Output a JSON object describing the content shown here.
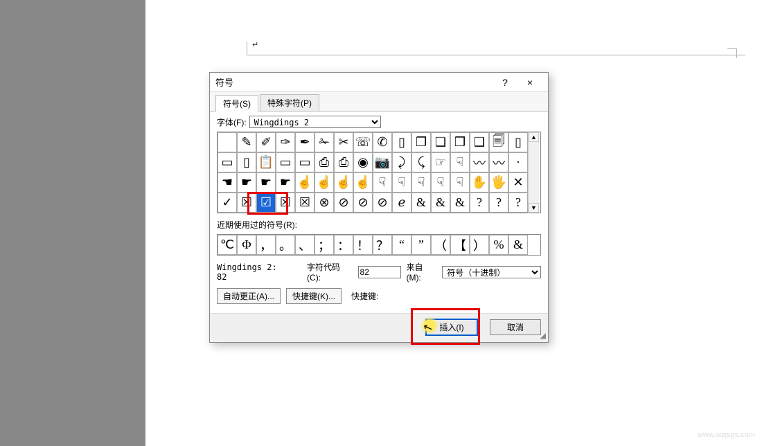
{
  "dialog": {
    "title": "符号",
    "help": "?",
    "close": "×",
    "tabs": {
      "symbols": "符号(S)",
      "special": "特殊字符(P)"
    },
    "font_label": "字体(F):",
    "font_value": "Wingdings 2",
    "recent_label": "近期使用过的符号(R):",
    "unicode_name": "Wingdings 2: 82",
    "char_code_label": "字符代码(C):",
    "char_code_value": "82",
    "from_label": "来自(M):",
    "from_value": "符号（十进制）",
    "autocorrect": "自动更正(A)...",
    "shortcut": "快捷键(K)...",
    "shortcut_label": "快捷键:",
    "insert": "插入(I)",
    "cancel": "取消"
  },
  "grid": {
    "rows": [
      [
        "",
        "pen1",
        "pen2",
        "pen3",
        "pen4",
        "scissors1",
        "scissors2",
        "phone",
        "phone2",
        "page",
        "pages",
        "pages2",
        "pages3",
        "pages4",
        "files",
        "page2"
      ],
      [
        "rect",
        "doc",
        "clip",
        "book",
        "book2",
        "print",
        "print2",
        "target",
        "camera",
        "curl",
        "curl2",
        "hand-l",
        "hand-r",
        "swoosh",
        "swoosh2",
        "dot"
      ],
      [
        "point-l",
        "point-r",
        "point-r2",
        "point-r3",
        "finger-u",
        "finger-u2",
        "finger-u3",
        "finger-u4",
        "finger-d",
        "finger-d2",
        "finger-d3",
        "finger-d4",
        "finger-d5",
        "stop",
        "wave",
        "x"
      ],
      [
        "check",
        "xbox1",
        "checkbox",
        "xbox2",
        "xbox3",
        "circle-x",
        "circle-o",
        "prohibit",
        "prohibit2",
        "er",
        "amp",
        "amp2",
        "amp3",
        "q1",
        "q2",
        "q3"
      ]
    ],
    "selected": {
      "row": 3,
      "col": 2
    }
  },
  "glyph_map": {
    "pen1": "✎",
    "pen2": "✐",
    "pen3": "✑",
    "pen4": "✒",
    "scissors1": "✁",
    "scissors2": "✂",
    "phone": "☏",
    "phone2": "✆",
    "page": "▯",
    "pages": "❐",
    "pages2": "❏",
    "pages3": "❒",
    "pages4": "❑",
    "files": "🗐",
    "page2": "▯",
    "rect": "▭",
    "doc": "▯",
    "clip": "📋",
    "book": "▭",
    "book2": "▭",
    "print": "⎙",
    "print2": "⎙",
    "target": "◉",
    "camera": "📷",
    "curl": "⤸",
    "curl2": "⤹",
    "hand-l": "☞",
    "hand-r": "☟",
    "swoosh": "〰",
    "swoosh2": "〰",
    "dot": "·",
    "point-l": "☚",
    "point-r": "☛",
    "point-r2": "☛",
    "point-r3": "☛",
    "finger-u": "☝",
    "finger-u2": "☝",
    "finger-u3": "☝",
    "finger-u4": "☝",
    "finger-d": "☟",
    "finger-d2": "☟",
    "finger-d3": "☟",
    "finger-d4": "☟",
    "finger-d5": "☟",
    "stop": "✋",
    "wave": "🖐",
    "x": "✕",
    "check": "✓",
    "xbox1": "☒",
    "checkbox": "☑",
    "xbox2": "☒",
    "xbox3": "☒",
    "circle-x": "⊗",
    "circle-o": "⊘",
    "prohibit": "⊘",
    "prohibit2": "⊘",
    "er": "ℯ",
    "amp": "&",
    "amp2": "&",
    "amp3": "&",
    "q1": "?",
    "q2": "?",
    "q3": "?"
  },
  "recent": [
    "℃",
    "Φ",
    "，",
    "。",
    "、",
    "；",
    "：",
    "！",
    "？",
    "“",
    "”",
    "（",
    "【",
    "）",
    "%",
    "&"
  ],
  "watermark": "www.wzjsgs.com"
}
